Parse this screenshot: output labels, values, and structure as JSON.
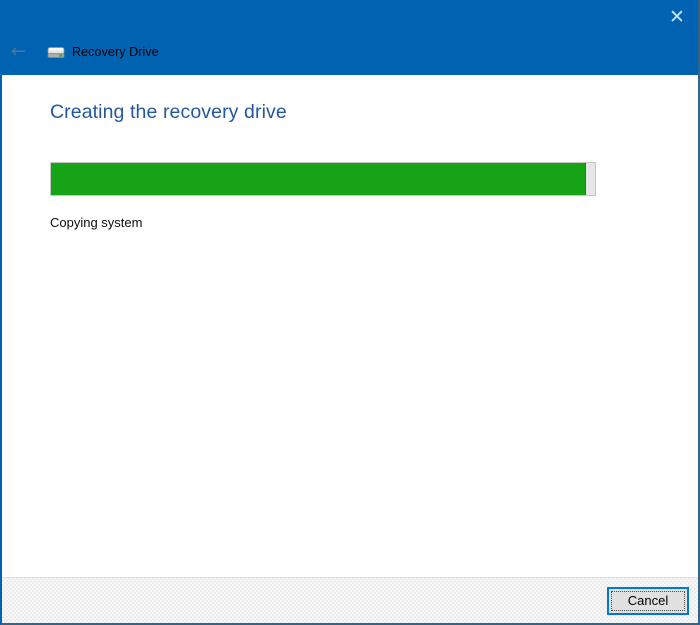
{
  "header": {
    "title": "Recovery Drive",
    "back_icon": "←",
    "close_icon": "✕"
  },
  "main": {
    "heading": "Creating the recovery drive",
    "status": "Copying system",
    "progress": {
      "percent": 98,
      "fill_style": "width:98.4%"
    }
  },
  "footer": {
    "cancel_label": "Cancel"
  },
  "colors": {
    "titlebar_bg": "#0063b1",
    "heading_text": "#2457a0",
    "progress_fill": "#16a316",
    "progress_track": "#e6e6e6",
    "button_focus_border": "#0078d7",
    "footer_bg": "#f0f0f0"
  }
}
